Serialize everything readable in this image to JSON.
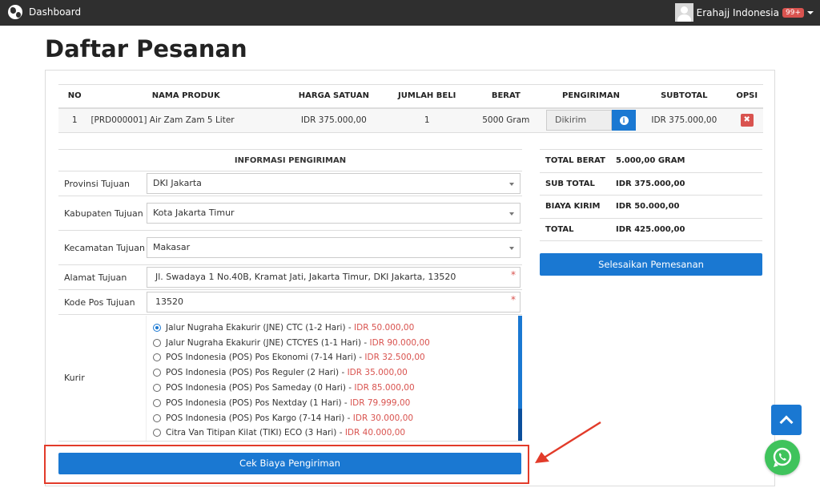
{
  "navbar": {
    "brand_label": "Dashboard",
    "user_name": "Erahajj Indonesia",
    "notification_badge": "99+"
  },
  "page": {
    "title": "Daftar Pesanan"
  },
  "order_table": {
    "headers": [
      "NO",
      "NAMA PRODUK",
      "HARGA SATUAN",
      "JUMLAH BELI",
      "BERAT",
      "PENGIRIMAN",
      "SUBTOTAL",
      "OPSI"
    ],
    "rows": [
      {
        "no": "1",
        "product": "[PRD000001] Air Zam Zam 5 Liter",
        "unit_price": "IDR 375.000,00",
        "quantity": "1",
        "weight": "5000 Gram",
        "shipping_status": "Dikirim",
        "subtotal": "IDR 375.000,00",
        "delete_symbol": "✖"
      }
    ]
  },
  "shipping_info": {
    "heading": "INFORMASI PENGIRIMAN",
    "province_label": "Provinsi Tujuan",
    "province_value": "DKI Jakarta",
    "regency_label": "Kabupaten Tujuan",
    "regency_value": "Kota Jakarta Timur",
    "district_label": "Kecamatan Tujuan",
    "district_value": "Makasar",
    "address_label": "Alamat Tujuan",
    "address_value": "Jl. Swadaya 1 No.40B, Kramat Jati, Jakarta Timur, DKI Jakarta, 13520",
    "postal_label": "Kode Pos Tujuan",
    "postal_value": "13520",
    "required_mark": "*",
    "courier_label": "Kurir",
    "courier_options": [
      {
        "name": "Jalur Nugraha Ekakurir (JNE) CTC (1-2 Hari)",
        "sep": " - ",
        "price": "IDR 50.000,00",
        "selected": true
      },
      {
        "name": "Jalur Nugraha Ekakurir (JNE) CTCYES (1-1 Hari)",
        "sep": " - ",
        "price": "IDR 90.000,00",
        "selected": false
      },
      {
        "name": "POS Indonesia (POS) Pos Ekonomi (7-14 Hari)",
        "sep": " - ",
        "price": "IDR 32.500,00",
        "selected": false
      },
      {
        "name": "POS Indonesia (POS) Pos Reguler (2 Hari)",
        "sep": " - ",
        "price": "IDR 35.000,00",
        "selected": false
      },
      {
        "name": "POS Indonesia (POS) Pos Sameday (0 Hari)",
        "sep": " - ",
        "price": "IDR 85.000,00",
        "selected": false
      },
      {
        "name": "POS Indonesia (POS) Pos Nextday (1 Hari)",
        "sep": " - ",
        "price": "IDR 79.999,00",
        "selected": false
      },
      {
        "name": "POS Indonesia (POS) Pos Kargo (7-14 Hari)",
        "sep": " - ",
        "price": "IDR 30.000,00",
        "selected": false
      },
      {
        "name": "Citra Van Titipan Kilat (TIKI) ECO (3 Hari)",
        "sep": " - ",
        "price": "IDR 40.000,00",
        "selected": false
      }
    ],
    "check_button": "Cek Biaya Pengiriman"
  },
  "summary": {
    "rows": [
      {
        "label": "TOTAL BERAT",
        "value": "5.000,00 GRAM"
      },
      {
        "label": "SUB TOTAL",
        "value": "IDR 375.000,00"
      },
      {
        "label": "BIAYA KIRIM",
        "value": "IDR 50.000,00"
      },
      {
        "label": "TOTAL",
        "value": "IDR 425.000,00"
      }
    ],
    "finish_button": "Selesaikan Pemesanan"
  },
  "colors": {
    "navbar": "#2f2f2f",
    "primary": "#1a78d2",
    "danger": "#d9534f",
    "highlight": "#e23b2a",
    "whatsapp": "#3fc35c"
  },
  "icons": [
    "globe-icon",
    "avatar",
    "chevron-down-icon",
    "info-icon",
    "close-icon",
    "chevron-up-icon",
    "whatsapp-icon",
    "arrow-icon"
  ]
}
